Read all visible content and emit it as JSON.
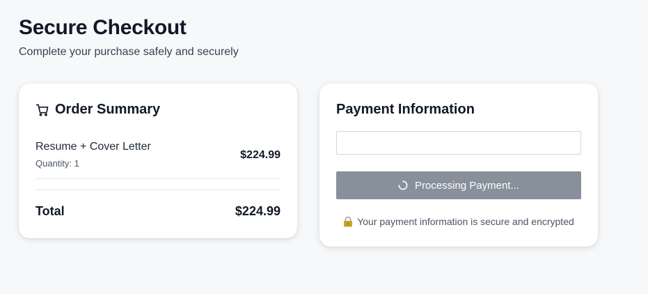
{
  "header": {
    "title": "Secure Checkout",
    "subtitle": "Complete your purchase safely and securely"
  },
  "order_summary": {
    "title": "Order Summary",
    "icon": "shopping-cart-icon",
    "items": [
      {
        "name": "Resume + Cover Letter",
        "quantity": "Quantity: 1",
        "price": "$224.99"
      }
    ],
    "total_label": "Total",
    "total_value": "$224.99"
  },
  "payment": {
    "title": "Payment Information",
    "card_field_value": "",
    "button_label": "Processing Payment...",
    "button_icon": "spinner-icon",
    "secure_note": "Your payment information is secure and encrypted",
    "secure_icon": "lock-icon"
  },
  "colors": {
    "background": "#f7f8fa",
    "card": "#ffffff",
    "button_disabled": "#87909b",
    "text_primary": "#111827",
    "text_secondary": "#4b5563"
  }
}
